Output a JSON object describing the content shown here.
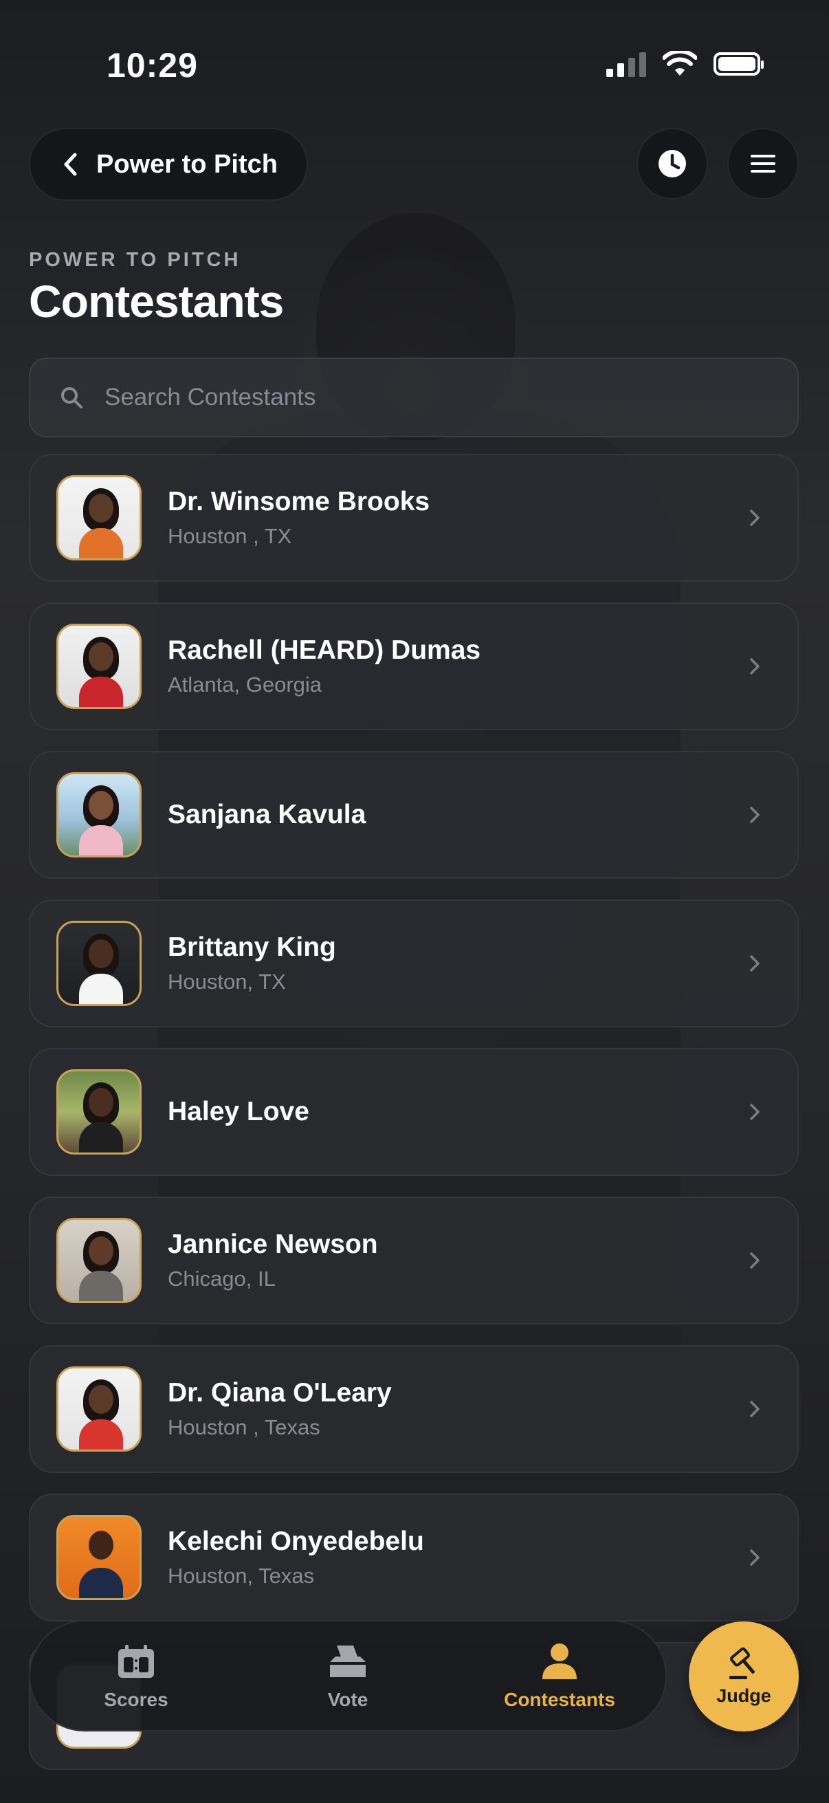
{
  "status_bar": {
    "time": "10:29"
  },
  "header": {
    "back_label": "Power to Pitch",
    "eyebrow": "POWER TO PITCH",
    "title": "Contestants"
  },
  "search": {
    "placeholder": "Search Contestants",
    "value": ""
  },
  "contestants": [
    {
      "name": "Dr. Winsome Brooks",
      "location": "Houston , TX"
    },
    {
      "name": "Rachell (HEARD) Dumas",
      "location": "Atlanta, Georgia"
    },
    {
      "name": "Sanjana Kavula",
      "location": ""
    },
    {
      "name": "Brittany King",
      "location": "Houston, TX"
    },
    {
      "name": "Haley Love",
      "location": ""
    },
    {
      "name": "Jannice Newson",
      "location": "Chicago, IL"
    },
    {
      "name": "Dr. Qiana O'Leary",
      "location": "Houston , Texas"
    },
    {
      "name": "Kelechi Onyedebelu",
      "location": "Houston, Texas"
    }
  ],
  "tabs": [
    {
      "label": "Scores",
      "icon": "scoreboard-icon",
      "active": false
    },
    {
      "label": "Vote",
      "icon": "ballot-box-icon",
      "active": false
    },
    {
      "label": "Contestants",
      "icon": "person-icon",
      "active": true
    }
  ],
  "judge_button": {
    "label": "Judge",
    "icon": "gavel-icon"
  },
  "colors": {
    "accent": "#efb94e",
    "active_tab": "#e9b24a",
    "card": "#2a2b30",
    "avatar_border": "#c9a25a"
  }
}
